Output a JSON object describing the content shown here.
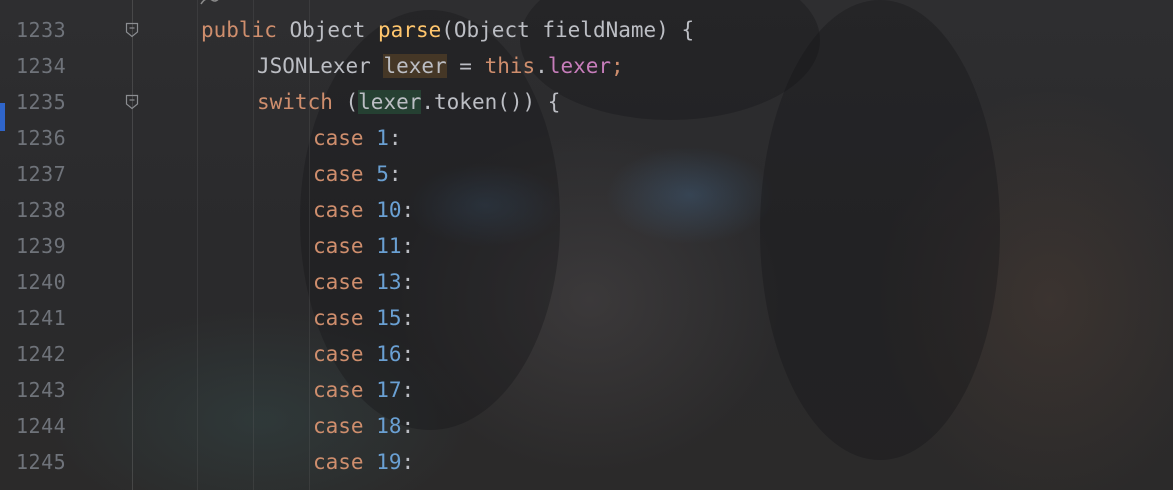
{
  "editor": {
    "lines": [
      {
        "no": "1233",
        "tokens": [
          {
            "t": "public",
            "c": "kw"
          },
          {
            "t": " Object ",
            "c": "plain"
          },
          {
            "t": "parse",
            "c": "fn"
          },
          {
            "t": "(Object fieldName) {",
            "c": "plain"
          }
        ],
        "indent": 0,
        "fold": true
      },
      {
        "no": "1234",
        "tokens": [
          {
            "t": "JSONLexer ",
            "c": "plain"
          },
          {
            "t": "lexer",
            "c": "plain",
            "hl": "var"
          },
          {
            "t": " = ",
            "c": "plain"
          },
          {
            "t": "this",
            "c": "kw"
          },
          {
            "t": ".",
            "c": "plain"
          },
          {
            "t": "lexer",
            "c": "field"
          },
          {
            "t": ";",
            "c": "kw"
          }
        ],
        "indent": 1,
        "fold": false
      },
      {
        "no": "1235",
        "tokens": [
          {
            "t": "switch",
            "c": "kw"
          },
          {
            "t": " (",
            "c": "plain"
          },
          {
            "t": "lexer",
            "c": "plain",
            "hl": "green"
          },
          {
            "t": ".token()) {",
            "c": "plain"
          }
        ],
        "indent": 1,
        "fold": true
      },
      {
        "no": "1236",
        "tokens": [
          {
            "t": "case ",
            "c": "kw"
          },
          {
            "t": "1",
            "c": "num"
          },
          {
            "t": ":",
            "c": "plain"
          }
        ],
        "indent": 2,
        "fold": false
      },
      {
        "no": "1237",
        "tokens": [
          {
            "t": "case ",
            "c": "kw"
          },
          {
            "t": "5",
            "c": "num"
          },
          {
            "t": ":",
            "c": "plain"
          }
        ],
        "indent": 2,
        "fold": false
      },
      {
        "no": "1238",
        "tokens": [
          {
            "t": "case ",
            "c": "kw"
          },
          {
            "t": "10",
            "c": "num"
          },
          {
            "t": ":",
            "c": "plain"
          }
        ],
        "indent": 2,
        "fold": false
      },
      {
        "no": "1239",
        "tokens": [
          {
            "t": "case ",
            "c": "kw"
          },
          {
            "t": "11",
            "c": "num"
          },
          {
            "t": ":",
            "c": "plain"
          }
        ],
        "indent": 2,
        "fold": false
      },
      {
        "no": "1240",
        "tokens": [
          {
            "t": "case ",
            "c": "kw"
          },
          {
            "t": "13",
            "c": "num"
          },
          {
            "t": ":",
            "c": "plain"
          }
        ],
        "indent": 2,
        "fold": false
      },
      {
        "no": "1241",
        "tokens": [
          {
            "t": "case ",
            "c": "kw"
          },
          {
            "t": "15",
            "c": "num"
          },
          {
            "t": ":",
            "c": "plain"
          }
        ],
        "indent": 2,
        "fold": false
      },
      {
        "no": "1242",
        "tokens": [
          {
            "t": "case ",
            "c": "kw"
          },
          {
            "t": "16",
            "c": "num"
          },
          {
            "t": ":",
            "c": "plain"
          }
        ],
        "indent": 2,
        "fold": false
      },
      {
        "no": "1243",
        "tokens": [
          {
            "t": "case ",
            "c": "kw"
          },
          {
            "t": "17",
            "c": "num"
          },
          {
            "t": ":",
            "c": "plain"
          }
        ],
        "indent": 2,
        "fold": false
      },
      {
        "no": "1244",
        "tokens": [
          {
            "t": "case ",
            "c": "kw"
          },
          {
            "t": "18",
            "c": "num"
          },
          {
            "t": ":",
            "c": "plain"
          }
        ],
        "indent": 2,
        "fold": false
      },
      {
        "no": "1245",
        "tokens": [
          {
            "t": "case ",
            "c": "kw"
          },
          {
            "t": "19",
            "c": "num"
          },
          {
            "t": ":",
            "c": "plain"
          }
        ],
        "indent": 2,
        "fold": false
      }
    ]
  },
  "colors": {
    "keyword": "#cf8e6d",
    "number": "#6aa0d3",
    "method": "#ffc66d",
    "field": "#c77dbb",
    "text": "#bcbec4",
    "line_number": "#6f737a",
    "accent": "#2f65ca"
  },
  "icons": {
    "fold_marker": "fold-marker-icon",
    "annotation_glyph": "method-annotation-icon"
  }
}
